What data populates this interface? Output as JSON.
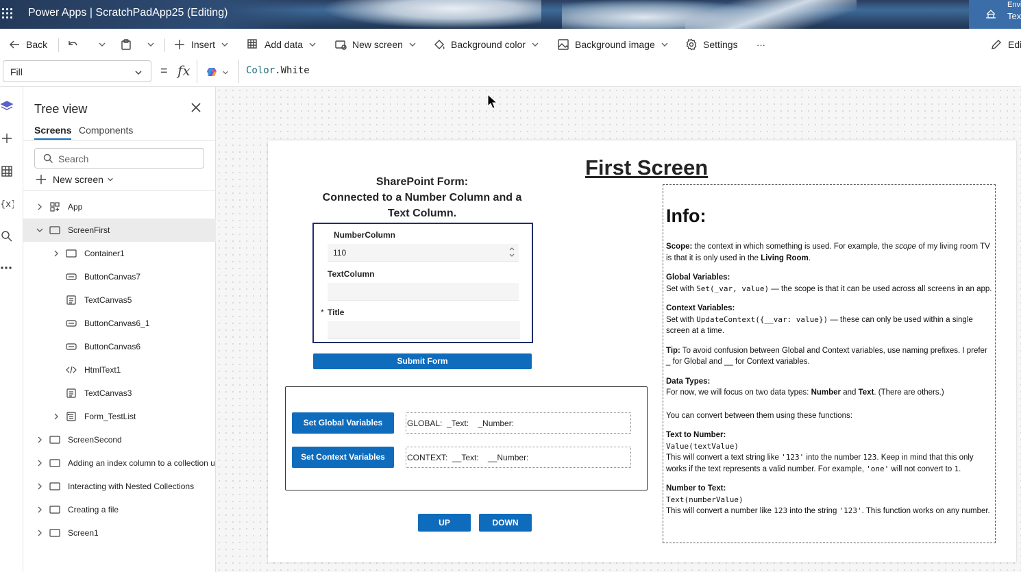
{
  "titlebar": {
    "app_title": "Power Apps  |  ScratchPadApp25 (Editing)",
    "env_label": "Envi",
    "env_value": "Tex"
  },
  "toolbar": {
    "back": "Back",
    "insert": "Insert",
    "add_data": "Add data",
    "new_screen": "New screen",
    "background_color": "Background color",
    "background_image": "Background image",
    "settings": "Settings",
    "more": "···",
    "edit": "Edi"
  },
  "formula_bar": {
    "property": "Fill",
    "equals": "=",
    "fx": "fx",
    "formula_object": "Color",
    "formula_member": ".White"
  },
  "tree": {
    "title": "Tree view",
    "tabs": [
      "Screens",
      "Components"
    ],
    "search_placeholder": "Search",
    "new_screen": "New screen",
    "items": [
      {
        "label": "App",
        "icon": "app-icon",
        "level": 0,
        "expandable": true,
        "selected": false
      },
      {
        "label": "ScreenFirst",
        "icon": "screen-icon",
        "level": 0,
        "expandable": true,
        "expanded": true,
        "selected": true
      },
      {
        "label": "Container1",
        "icon": "container-icon",
        "level": 1,
        "expandable": true,
        "selected": false
      },
      {
        "label": "ButtonCanvas7",
        "icon": "button-icon",
        "level": 1,
        "expandable": false,
        "selected": false
      },
      {
        "label": "TextCanvas5",
        "icon": "text-icon",
        "level": 1,
        "expandable": false,
        "selected": false
      },
      {
        "label": "ButtonCanvas6_1",
        "icon": "button-icon",
        "level": 1,
        "expandable": false,
        "selected": false
      },
      {
        "label": "ButtonCanvas6",
        "icon": "button-icon",
        "level": 1,
        "expandable": false,
        "selected": false
      },
      {
        "label": "HtmlText1",
        "icon": "html-icon",
        "level": 1,
        "expandable": false,
        "selected": false
      },
      {
        "label": "TextCanvas3",
        "icon": "text-icon",
        "level": 1,
        "expandable": false,
        "selected": false
      },
      {
        "label": "Form_TestList",
        "icon": "form-icon",
        "level": 1,
        "expandable": true,
        "selected": false
      },
      {
        "label": "ScreenSecond",
        "icon": "screen-icon",
        "level": 0,
        "expandable": true,
        "selected": false
      },
      {
        "label": "Adding an index column to a collection u",
        "icon": "screen-icon",
        "level": 0,
        "expandable": true,
        "selected": false
      },
      {
        "label": "Interacting with Nested Collections",
        "icon": "screen-icon",
        "level": 0,
        "expandable": true,
        "selected": false
      },
      {
        "label": "Creating a file",
        "icon": "screen-icon",
        "level": 0,
        "expandable": true,
        "selected": false
      },
      {
        "label": "Screen1",
        "icon": "screen-icon",
        "level": 0,
        "expandable": true,
        "selected": false
      }
    ]
  },
  "canvas": {
    "screen_title": "First Screen",
    "sp_title_1": "SharePoint Form:",
    "sp_title_2": "Connected to a Number Column and a Text Column.",
    "form": {
      "number_label": "NumberColumn",
      "number_value": "110",
      "text_label": "TextColumn",
      "text_value": "",
      "title_required": "*",
      "title_label": "Title",
      "title_value": ""
    },
    "submit": "Submit Form",
    "set_global": "Set Global Variables",
    "set_context": "Set Context Variables",
    "global_text": "GLOBAL:  _Text:    _Number:",
    "context_text": "CONTEXT:  __Text:    __Number:",
    "up": "UP",
    "down": "DOWN"
  },
  "info": {
    "heading": "Info:",
    "scope_b": "Scope:",
    "scope_1": " the context in which something is used. For example, the ",
    "scope_i": "scope",
    "scope_2": " of my living room TV is that it is only used in the ",
    "scope_b2": "Living Room",
    "scope_3": ".",
    "global_h": "Global Variables:",
    "global_1": "Set with ",
    "global_code": "Set(_var, value)",
    "global_2": " — the scope is that it can be used across all screens in an app.",
    "context_h": "Context Variables:",
    "context_1": "Set with ",
    "context_code": "UpdateContext({__var: value})",
    "context_2": " — these can only be used within a single screen at a time.",
    "tip_b": "Tip:",
    "tip": " To avoid confusion between Global and Context variables, use naming prefixes. I prefer _ for Global and __ for Context variables.",
    "types_h": "Data Types:",
    "types_1": "For now, we will focus on two data types: ",
    "types_b1": "Number",
    "types_and": " and ",
    "types_b2": "Text",
    "types_2": ". (There are others.)",
    "convert": "You can convert between them using these functions:",
    "t2n_h": "Text to Number:",
    "t2n_code": "Value(textValue)",
    "t2n_1": "This will convert a text string like ",
    "t2n_c1": "'123'",
    "t2n_2": " into the number ",
    "t2n_c2": "123",
    "t2n_3": ". Keep in mind that this only works if the text represents a valid number. For example, ",
    "t2n_c3": "'one'",
    "t2n_4": " will not convert to ",
    "t2n_c4": "1",
    "t2n_5": ".",
    "n2t_h": "Number to Text:",
    "n2t_code": "Text(numberValue)",
    "n2t_1": "This will convert a number like ",
    "n2t_c1": "123",
    "n2t_2": " into the string ",
    "n2t_c2": "'123'",
    "n2t_3": ". This function works on any number."
  },
  "colors": {
    "accent": "#0f6cbd",
    "form_border": "#1f2e69",
    "selected_row": "#ebebeb"
  }
}
